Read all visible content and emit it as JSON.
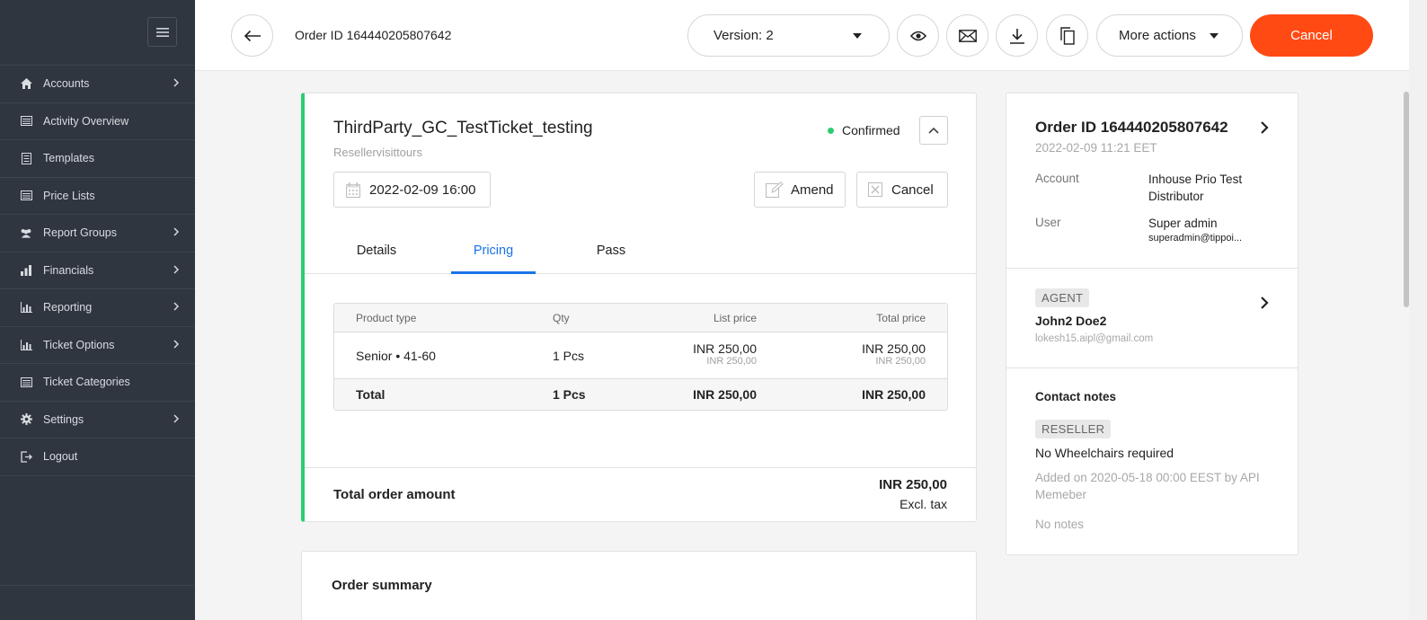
{
  "sidebar": {
    "items": [
      {
        "label": "Accounts",
        "icon": "home-icon",
        "has_chevron": true
      },
      {
        "label": "Activity Overview",
        "icon": "list-icon",
        "has_chevron": false
      },
      {
        "label": "Templates",
        "icon": "document-icon",
        "has_chevron": false
      },
      {
        "label": "Price Lists",
        "icon": "list-icon",
        "has_chevron": false
      },
      {
        "label": "Report Groups",
        "icon": "users-icon",
        "has_chevron": true
      },
      {
        "label": "Financials",
        "icon": "bar-chart-icon",
        "has_chevron": true
      },
      {
        "label": "Reporting",
        "icon": "chart-icon",
        "has_chevron": true
      },
      {
        "label": "Ticket Options",
        "icon": "chart-icon",
        "has_chevron": true
      },
      {
        "label": "Ticket Categories",
        "icon": "list-icon",
        "has_chevron": false
      },
      {
        "label": "Settings",
        "icon": "gear-icon",
        "has_chevron": true
      },
      {
        "label": "Logout",
        "icon": "logout-icon",
        "has_chevron": false
      }
    ]
  },
  "header": {
    "order_id": "Order ID 164440205807642",
    "version_label": "Version: 2",
    "more_actions_label": "More actions",
    "cancel_label": "Cancel"
  },
  "ticket": {
    "title": "ThirdParty_GC_TestTicket_testing",
    "reseller": "Resellervisittours",
    "status": "Confirmed",
    "datetime": "2022-02-09 16:00",
    "amend_label": "Amend",
    "cancel_label": "Cancel",
    "tabs": [
      "Details",
      "Pricing",
      "Pass"
    ],
    "active_tab": "Pricing"
  },
  "pricing": {
    "headers": {
      "product_type": "Product type",
      "qty": "Qty",
      "list_price": "List price",
      "total_price": "Total price"
    },
    "rows": [
      {
        "product_type": "Senior • 41-60",
        "qty": "1 Pcs",
        "list_price": "INR 250,00",
        "list_price_sub": "INR 250,00",
        "total_price": "INR 250,00",
        "total_price_sub": "INR 250,00"
      }
    ],
    "total": {
      "label": "Total",
      "qty": "1 Pcs",
      "list_price": "INR 250,00",
      "total_price": "INR 250,00"
    }
  },
  "order_total": {
    "label": "Total order amount",
    "amount": "INR 250,00",
    "tax_note": "Excl. tax"
  },
  "summary": {
    "title": "Order summary"
  },
  "order_info": {
    "title": "Order ID 164440205807642",
    "date": "2022-02-09 11:21 EET",
    "account_label": "Account",
    "account_value": "Inhouse Prio Test Distributor",
    "user_label": "User",
    "user_value": "Super admin",
    "user_email": "superadmin@tippoi..."
  },
  "agent": {
    "badge": "AGENT",
    "name": "John2 Doe2",
    "email": "lokesh15.aipl@gmail.com"
  },
  "contact": {
    "title": "Contact notes",
    "badge": "RESELLER",
    "note": "No Wheelchairs required",
    "meta": "Added on 2020-05-18 00:00 EEST by API Memeber",
    "no_notes": "No notes"
  },
  "colors": {
    "sidebar_bg": "#2f3640",
    "accent_blue": "#1a73e8",
    "cancel_orange": "#ff4a14",
    "status_green": "#2ecc71"
  }
}
